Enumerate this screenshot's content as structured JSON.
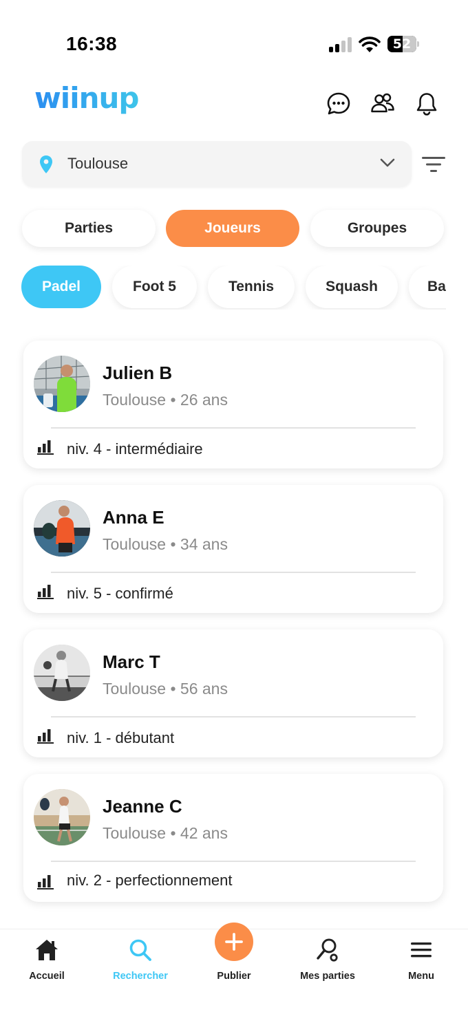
{
  "status_bar": {
    "time": "16:38",
    "battery_level": "52"
  },
  "header": {
    "logo_text": "wiinup",
    "icons": [
      "chat-icon",
      "friends-icon",
      "bell-icon"
    ]
  },
  "location": {
    "value": "Toulouse"
  },
  "segments": [
    {
      "label": "Parties",
      "active": false
    },
    {
      "label": "Joueurs",
      "active": true
    },
    {
      "label": "Groupes",
      "active": false
    }
  ],
  "sports": [
    {
      "label": "Padel",
      "active": true
    },
    {
      "label": "Foot 5",
      "active": false
    },
    {
      "label": "Tennis",
      "active": false
    },
    {
      "label": "Squash",
      "active": false
    },
    {
      "label": "Ba",
      "active": false
    }
  ],
  "players": [
    {
      "name": "Julien B",
      "meta": "Toulouse • 26 ans",
      "level": "niv. 4 - intermédiaire"
    },
    {
      "name": "Anna E",
      "meta": "Toulouse • 34 ans",
      "level": "niv. 5 - confirmé"
    },
    {
      "name": "Marc T",
      "meta": "Toulouse • 56 ans",
      "level": "niv. 1 - débutant"
    },
    {
      "name": "Jeanne C",
      "meta": "Toulouse • 42 ans",
      "level": "niv. 2 - perfectionnement"
    }
  ],
  "bottom_nav": [
    {
      "label": "Accueil",
      "icon": "home-icon",
      "active": false
    },
    {
      "label": "Rechercher",
      "icon": "search-icon",
      "active": true
    },
    {
      "label": "Publier",
      "icon": "plus-icon",
      "active": false
    },
    {
      "label": "Mes parties",
      "icon": "racket-icon",
      "active": false
    },
    {
      "label": "Menu",
      "icon": "hamburger-icon",
      "active": false
    }
  ],
  "colors": {
    "accent_orange": "#fb8d48",
    "accent_blue": "#3ec7f5",
    "logo_gradient_start": "#2b8ef0",
    "logo_gradient_end": "#3ec4ea"
  }
}
